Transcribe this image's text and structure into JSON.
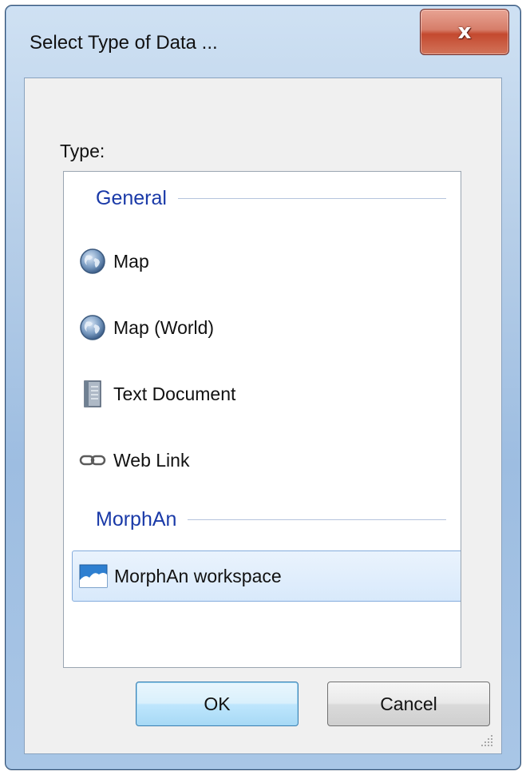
{
  "window": {
    "title": "Select Type of Data ...",
    "close_label": "x"
  },
  "type_label": "Type:",
  "groups": [
    {
      "name": "General",
      "items": [
        {
          "label": "Map",
          "icon": "globe-icon"
        },
        {
          "label": "Map (World)",
          "icon": "globe-icon"
        },
        {
          "label": "Text Document",
          "icon": "document-icon"
        },
        {
          "label": "Web Link",
          "icon": "link-icon"
        }
      ]
    },
    {
      "name": "MorphAn",
      "items": [
        {
          "label": "MorphAn workspace",
          "icon": "workspace-icon",
          "selected": true
        }
      ]
    }
  ],
  "buttons": {
    "ok": "OK",
    "cancel": "Cancel"
  },
  "colors": {
    "group_header": "#1a3aa8",
    "selection_fill": "#d8e9fb",
    "selection_border": "#84acdd",
    "close_button": "#c4492f"
  }
}
